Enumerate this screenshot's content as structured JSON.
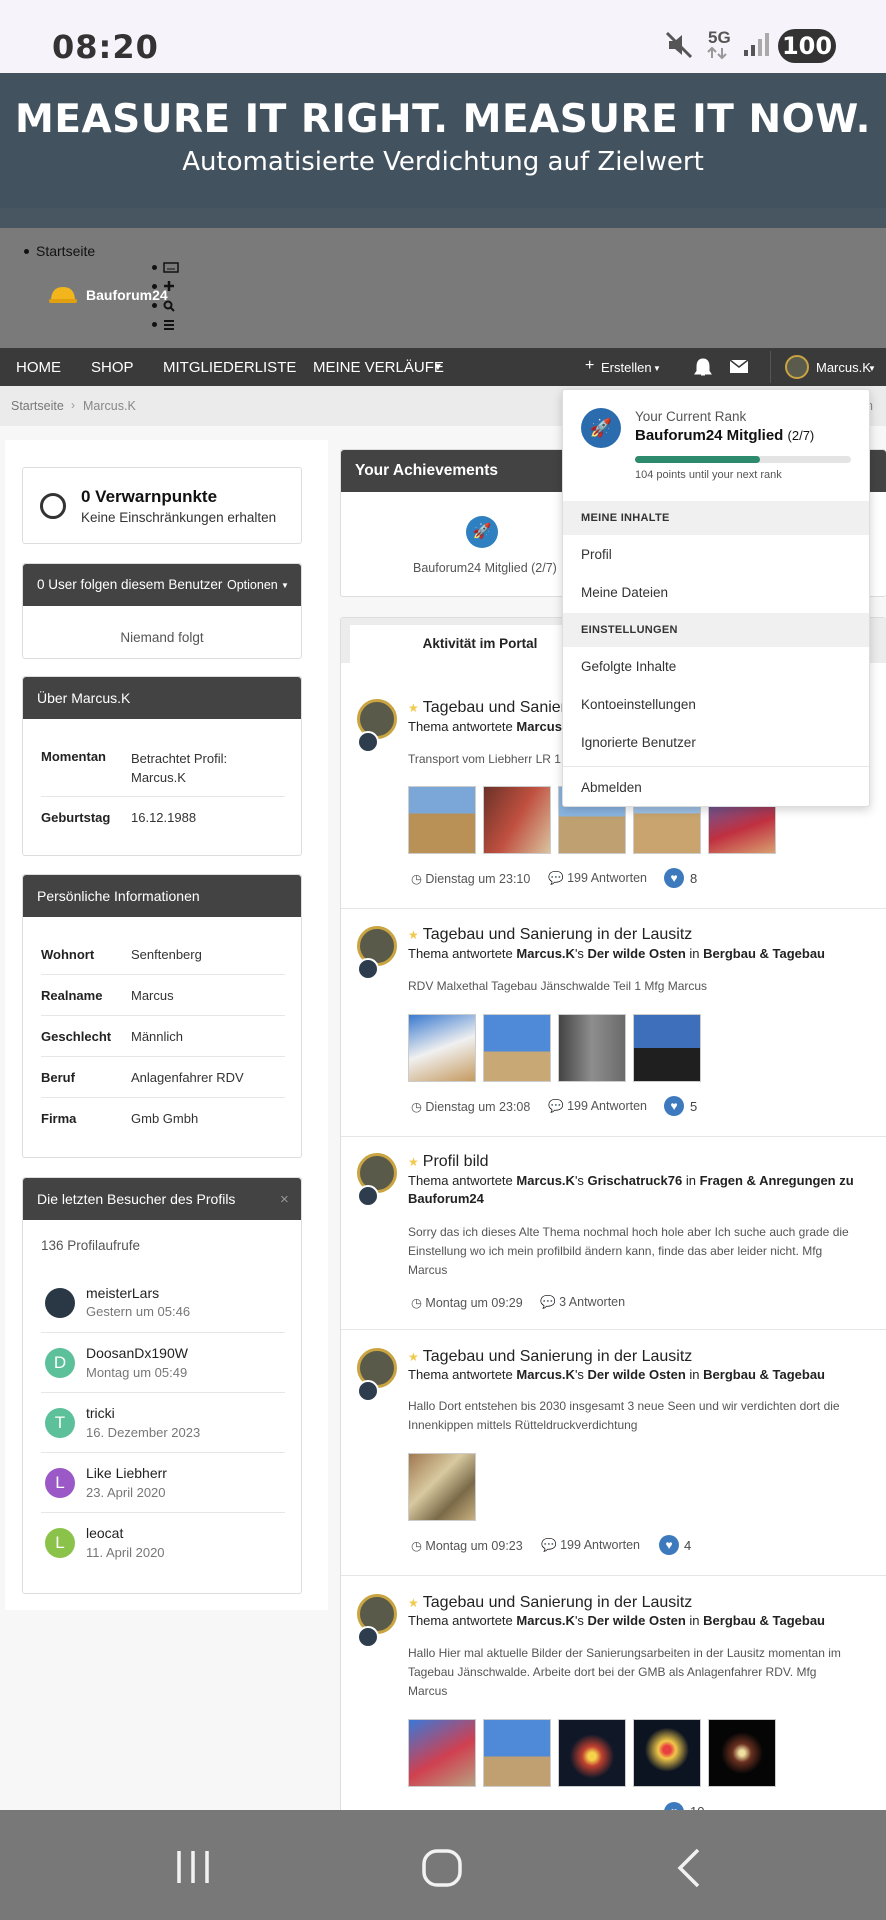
{
  "status": {
    "time": "08:20",
    "network": "5G",
    "battery": "100"
  },
  "banner": {
    "title": "MEASURE IT RIGHT. MEASURE IT NOW.",
    "subtitle": "Automatisierte Verdichtung auf Zielwert"
  },
  "header": {
    "breadcrumb_home": "Startseite",
    "logo_text": "Bauforum24"
  },
  "nav": {
    "items": [
      "HOME",
      "SHOP",
      "MITGLIEDERLISTE",
      "MEINE VERLÄUFE"
    ],
    "create_label": "Erstellen",
    "user_label": "Marcus.K"
  },
  "breadcrumb": {
    "home": "Startseite",
    "current": "Marcus.K",
    "right_fragment": "n"
  },
  "warn": {
    "title": "0 Verwarnpunkte",
    "subtitle": "Keine Einschränkungen erhalten"
  },
  "follow": {
    "header": "0 User folgen diesem Benutzer",
    "options": "Optionen",
    "empty": "Niemand folgt"
  },
  "about": {
    "header": "Über Marcus.K",
    "rows": [
      {
        "label": "Momentan",
        "value": "Betrachtet Profil: Marcus.K"
      },
      {
        "label": "Geburtstag",
        "value": "16.12.1988"
      }
    ]
  },
  "personal": {
    "header": "Persönliche Informationen",
    "rows": [
      {
        "label": "Wohnort",
        "value": "Senftenberg"
      },
      {
        "label": "Realname",
        "value": "Marcus"
      },
      {
        "label": "Geschlecht",
        "value": "Männlich"
      },
      {
        "label": "Beruf",
        "value": "Anlagenfahrer RDV"
      },
      {
        "label": "Firma",
        "value": "Gmb Gmbh"
      }
    ]
  },
  "visitors": {
    "header": "Die letzten Besucher des Profils",
    "count": "136 Profilaufrufe",
    "list": [
      {
        "initial": "",
        "name": "meisterLars",
        "time": "Gestern um 05:46",
        "color": "#2a3845"
      },
      {
        "initial": "D",
        "name": "DoosanDx190W",
        "time": "Montag um 05:49",
        "color": "#5cc09b"
      },
      {
        "initial": "T",
        "name": "tricki",
        "time": "16. Dezember 2023",
        "color": "#5cc09b"
      },
      {
        "initial": "L",
        "name": "Like Liebherr",
        "time": "23. April 2020",
        "color": "#9b59c7"
      },
      {
        "initial": "L",
        "name": "leocat",
        "time": "11. April 2020",
        "color": "#8bc34a"
      }
    ]
  },
  "achievements": {
    "header": "Your Achievements",
    "rank_label": "Bauforum24 Mitglied (2/7)"
  },
  "activity": {
    "tab": "Aktivität im Portal",
    "posts": [
      {
        "title": "Tagebau und Sanierung in der Lausitz",
        "prefix": "Thema antwortete",
        "user": "Marcus.K",
        "text1": "Transport vom Liebherr LR 1",
        "text2": "",
        "text3": "",
        "date": "Dienstag um 23:10",
        "replies": "199 Antworten",
        "likes": "8"
      },
      {
        "title": "Tagebau und Sanierung in der Lausitz",
        "prefix": "Thema antwortete",
        "user": "Marcus.K",
        "poss": "'s",
        "topic": "Der wilde Osten",
        "in": "in",
        "forum": "Bergbau & Tagebau",
        "text1": "RDV Malxethal Tagebau Jänschwalde Teil 1 Mfg Marcus",
        "date": "Dienstag um 23:08",
        "replies": "199 Antworten",
        "likes": "5"
      },
      {
        "title": "Profil bild",
        "prefix": "Thema antwortete",
        "user": "Marcus.K",
        "poss": "'s",
        "topic": "Grischatruck76",
        "in": "in",
        "forum": "Fragen & Anregungen zu",
        "forum2": "Bauforum24",
        "text1": "Sorry das ich dieses Alte Thema nochmal hoch hole aber Ich suche auch grade die",
        "text2": "Einstellung wo ich mein profilbild ändern kann, finde das aber leider nicht. Mfg",
        "text3": "Marcus",
        "date": "Montag um 09:29",
        "replies": "3 Antworten"
      },
      {
        "title": "Tagebau und Sanierung in der Lausitz",
        "prefix": "Thema antwortete",
        "user": "Marcus.K",
        "poss": "'s",
        "topic": "Der wilde Osten",
        "in": "in",
        "forum": "Bergbau & Tagebau",
        "text1": "Hallo Dort entstehen bis 2030 insgesamt 3 neue Seen und wir verdichten dort die",
        "text2": "Innenkippen mittels Rütteldruckverdichtung",
        "date": "Montag um 09:23",
        "replies": "199 Antworten",
        "likes": "4"
      },
      {
        "title": "Tagebau und Sanierung in der Lausitz",
        "prefix": "Thema antwortete",
        "user": "Marcus.K",
        "poss": "'s",
        "topic": "Der wilde Osten",
        "in": "in",
        "forum": "Bergbau & Tagebau",
        "text1": "Hallo Hier mal aktuelle Bilder der Sanierungsarbeiten in der Lausitz momentan im",
        "text2": "Tagebau Jänschwalde. Arbeite dort bei der GMB als Anlagenfahrer RDV. Mfg",
        "text3": "Marcus",
        "date": "",
        "replies": "",
        "likes": "10"
      }
    ]
  },
  "dropdown": {
    "rank_caption": "Your Current Rank",
    "rank_name": "Bauforum24 Mitglied",
    "rank_suffix": "(2/7)",
    "progress": 0.58,
    "points_note": "104 points until your next rank",
    "sec1": "MEINE INHALTE",
    "items1": [
      "Profil",
      "Meine Dateien"
    ],
    "sec2": "EINSTELLUNGEN",
    "items2": [
      "Gefolgte Inhalte",
      "Kontoeinstellungen",
      "Ignorierte Benutzer"
    ],
    "logout": "Abmelden"
  }
}
